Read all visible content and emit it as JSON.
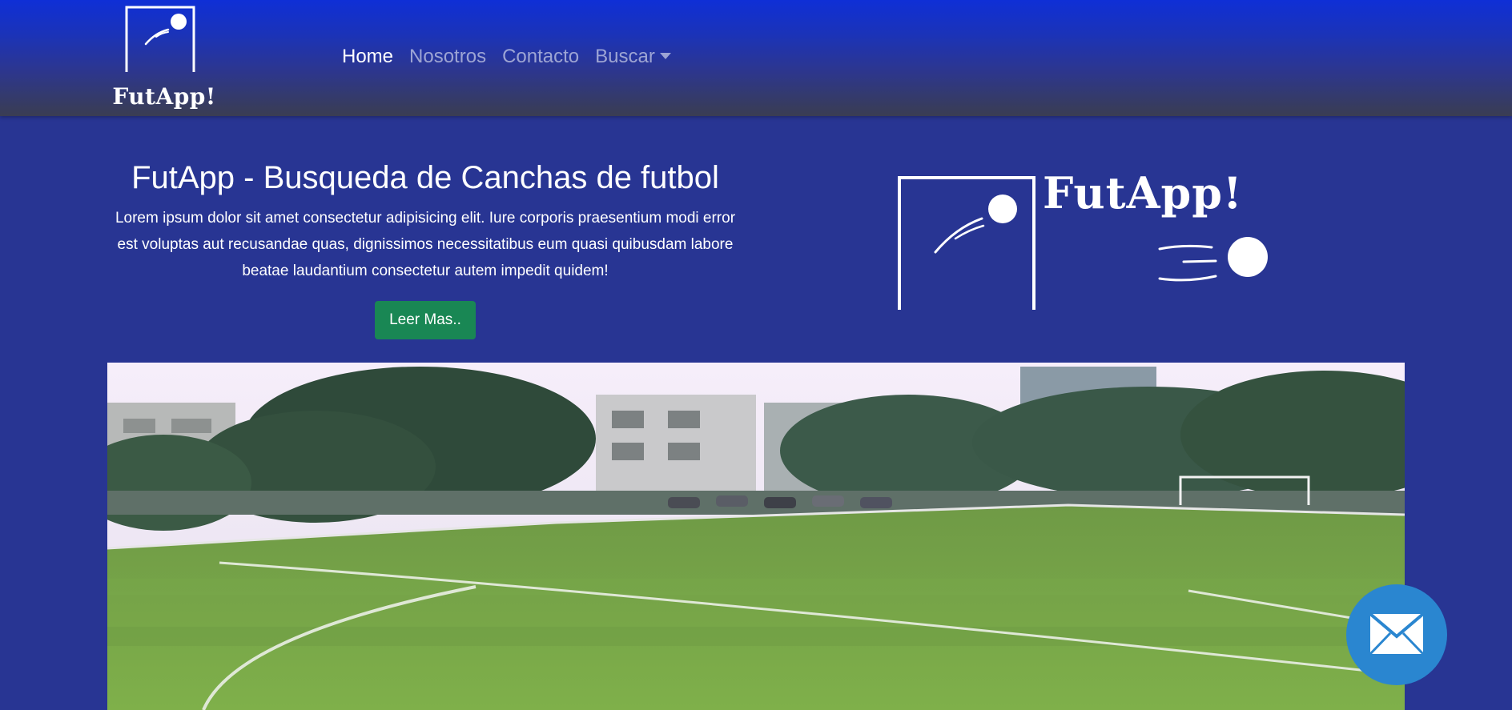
{
  "navbar": {
    "brand": {
      "name": "FutApp!"
    },
    "links": [
      {
        "label": "Home",
        "active": true
      },
      {
        "label": "Nosotros",
        "active": false
      },
      {
        "label": "Contacto",
        "active": false
      },
      {
        "label": "Buscar",
        "active": false,
        "dropdown": true
      }
    ],
    "gradient": [
      "#0f2fd6",
      "#3a3d52"
    ]
  },
  "hero": {
    "title": "FutApp - Busqueda de Canchas de futbol",
    "description": "Lorem ipsum dolor sit amet consectetur adipisicing elit. Iure corporis praesentium modi error est voluptas aut recusandae quas, dignissimos necessitatibus eum quasi quibusdam labore beatae laudantium consectetur autem impedit quidem!",
    "button_label": "Leer Mas..",
    "logo_text": "FutApp!"
  },
  "field_image": {
    "alt": "soccer-field-photo"
  },
  "floating_button": {
    "icon": "mail-icon"
  },
  "colors": {
    "page_bg": "#283593",
    "button_green": "#198754",
    "mail_blue": "#2a86d0"
  }
}
